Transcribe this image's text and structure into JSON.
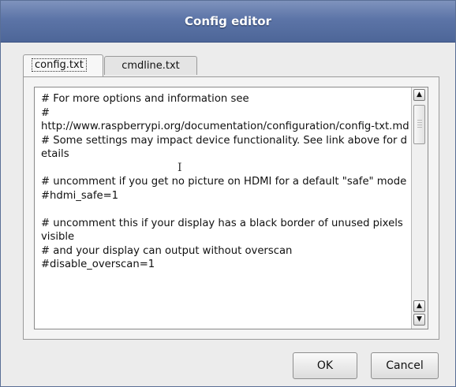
{
  "window": {
    "title": "Config editor"
  },
  "tabs": [
    {
      "label": "config.txt",
      "active": true
    },
    {
      "label": "cmdline.txt",
      "active": false
    }
  ],
  "editor": {
    "content": "# For more options and information see\n#\nhttp://www.raspberrypi.org/documentation/configuration/config-txt.md\n# Some settings may impact device functionality. See link above for details\n\n# uncomment if you get no picture on HDMI for a default \"safe\" mode\n#hdmi_safe=1\n\n# uncomment this if your display has a black border of unused pixels visible\n# and your display can output without overscan\n#disable_overscan=1"
  },
  "scrollbar": {
    "up_glyph": "▲",
    "down_glyph": "▼"
  },
  "buttons": {
    "ok_label": "OK",
    "cancel_label": "Cancel"
  },
  "cursor_glyph": "I"
}
